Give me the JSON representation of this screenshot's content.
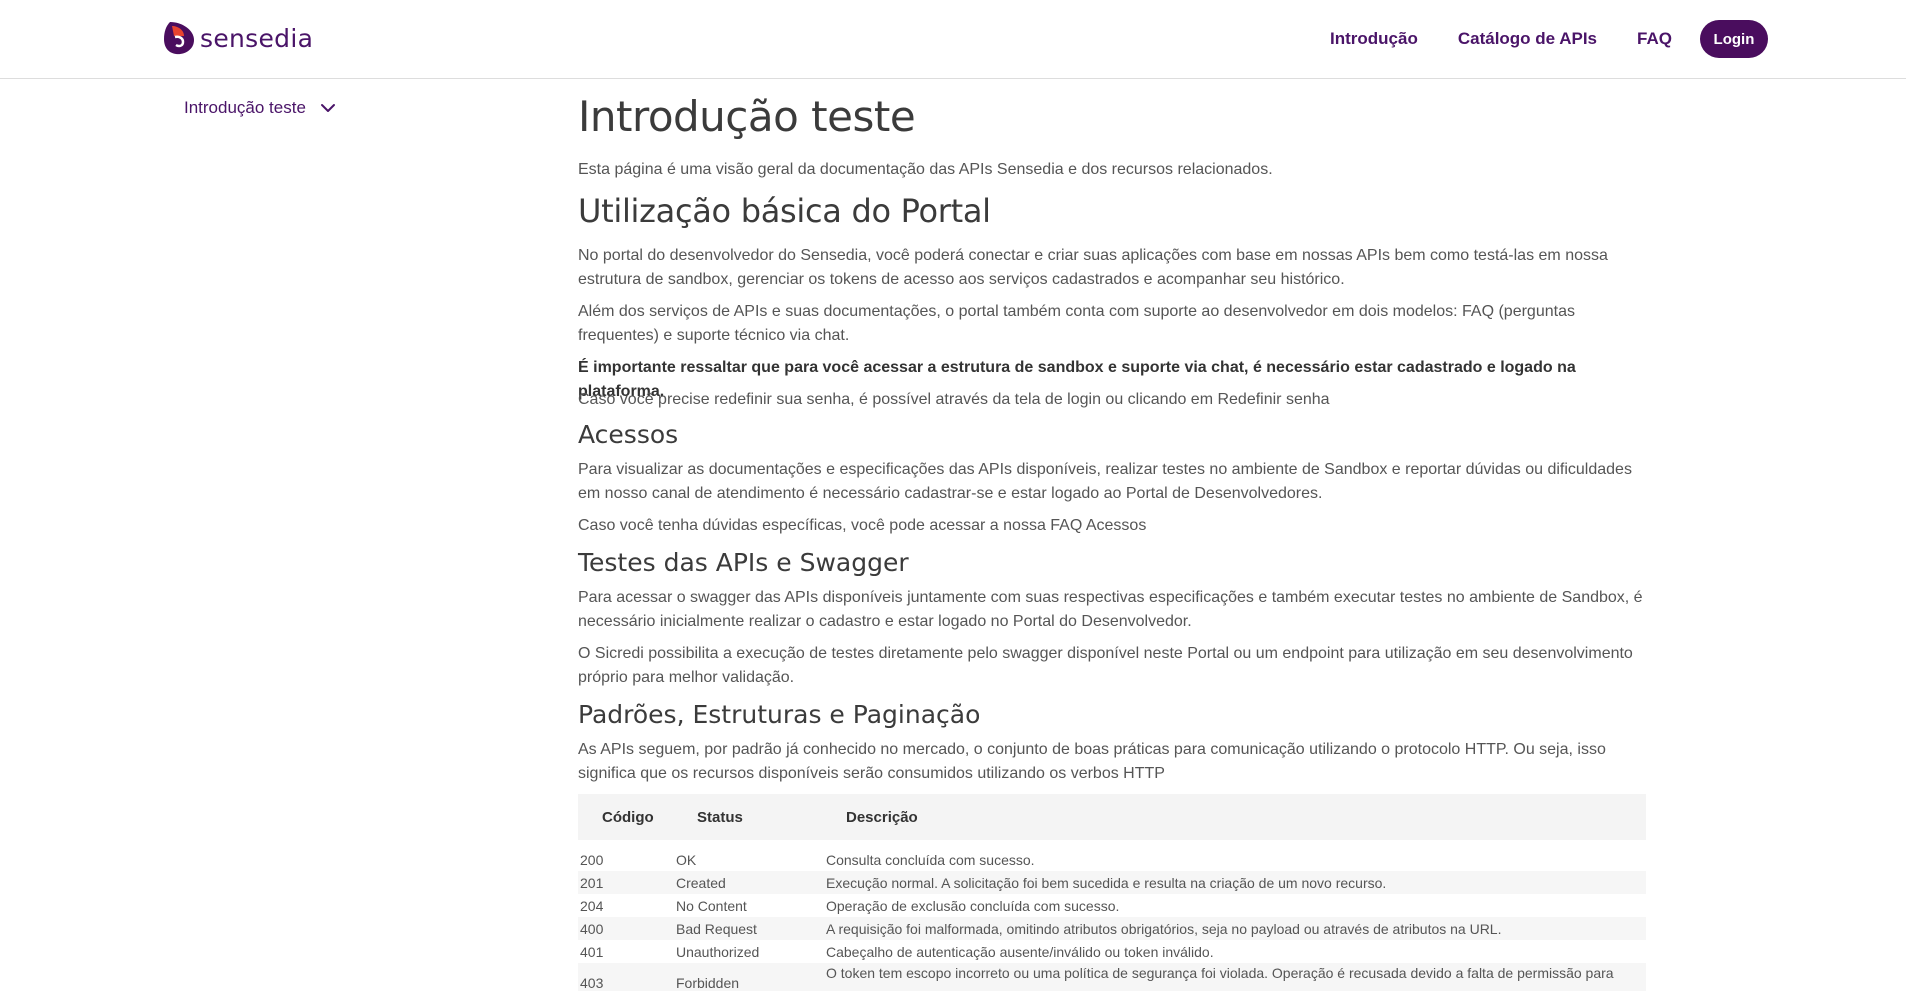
{
  "header": {
    "logo_text": "sensedia",
    "nav": [
      "Introdução",
      "Catálogo de APIs",
      "FAQ"
    ],
    "login_label": "Login"
  },
  "colors": {
    "brand": "#4a0d5e",
    "nav_text": "#4a1468"
  },
  "sidebar": {
    "item_label": "Introdução teste",
    "icon": "chevron-down-icon"
  },
  "content": {
    "title": "Introdução teste",
    "intro": "Esta página é uma visão geral da documentação das APIs Sensedia e dos recursos relacionados.",
    "sections": [
      {
        "heading": "Utilização básica do Portal",
        "paragraphs": [
          "No portal do desenvolvedor do Sensedia, você poderá conectar e criar suas aplicações com base em nossas APIs bem como testá-las em nossa estrutura de sandbox, gerenciar os tokens de acesso aos serviços cadastrados e acompanhar seu histórico.",
          "Além dos serviços de APIs e suas documentações, o portal também conta com suporte ao desenvolvedor em dois modelos: FAQ (perguntas frequentes) e suporte técnico via chat.",
          "É importante ressaltar que para você acessar a estrutura de sandbox e suporte via chat, é necessário estar cadastrado e logado na plataforma.",
          "Caso você precise redefinir sua senha, é possível através da tela de login ou clicando em Redefinir senha"
        ]
      },
      {
        "heading": "Acessos",
        "paragraphs": [
          "Para visualizar as documentações e especificações das APIs disponíveis, realizar testes no ambiente de Sandbox e reportar dúvidas ou dificuldades em nosso canal de atendimento é necessário cadastrar-se e estar logado ao Portal de Desenvolvedores.",
          "Caso você tenha dúvidas específicas, você pode acessar a nossa FAQ Acessos"
        ]
      },
      {
        "heading": "Testes das APIs e Swagger",
        "paragraphs": [
          "Para acessar o swagger das APIs disponíveis juntamente com suas respectivas especificações e também executar testes no ambiente de Sandbox, é necessário inicialmente realizar o cadastro e estar logado no Portal do Desenvolvedor.",
          "O Sicredi possibilita a execução de testes diretamente pelo swagger disponível neste Portal ou um endpoint para utilização em seu desenvolvimento próprio para melhor validação."
        ]
      },
      {
        "heading": "Padrões, Estruturas e Paginação",
        "paragraphs": [
          "As APIs seguem, por padrão já conhecido no mercado, o conjunto de boas práticas para comunicação utilizando o protocolo HTTP. Ou seja, isso significa que os recursos disponíveis serão consumidos utilizando os verbos HTTP"
        ]
      }
    ]
  },
  "table": {
    "headers": [
      "Código",
      "Status",
      "Descrição"
    ],
    "rows": [
      [
        "200",
        "OK",
        "Consulta concluída com sucesso."
      ],
      [
        "201",
        "Created",
        "Execução normal. A solicitação foi bem sucedida e resulta na criação de um novo recurso."
      ],
      [
        "204",
        "No Content",
        "Operação de exclusão concluída com sucesso."
      ],
      [
        "400",
        "Bad Request",
        "A requisição foi malformada, omitindo atributos obrigatórios, seja no payload ou através de atributos na URL."
      ],
      [
        "401",
        "Unauthorized",
        "Cabeçalho de autenticação ausente/inválido ou token inválido."
      ],
      [
        "403",
        "Forbidden",
        "O token tem escopo incorreto ou uma política de segurança foi violada. Operação é recusada devido a falta de permissão para"
      ]
    ]
  }
}
